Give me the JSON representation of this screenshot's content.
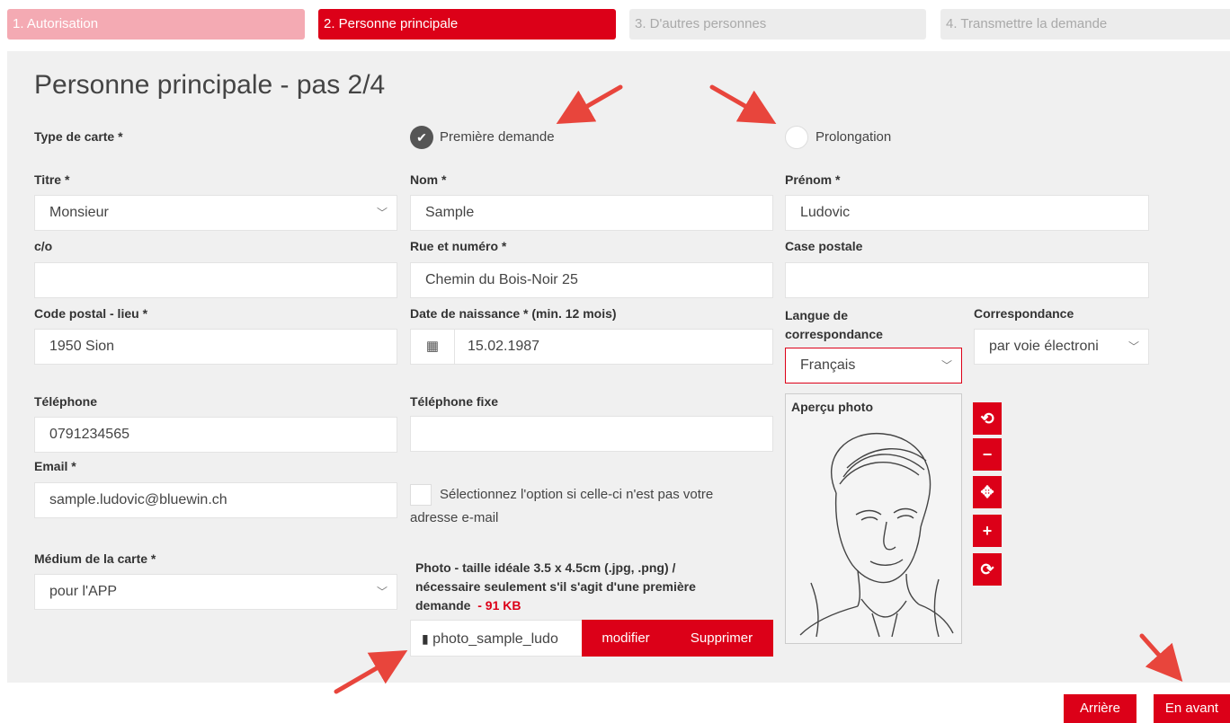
{
  "steps": [
    {
      "label": "1. Autorisation"
    },
    {
      "label": "2. Personne principale"
    },
    {
      "label": "3. D'autres personnes"
    },
    {
      "label": "4. Transmettre la demande"
    }
  ],
  "page_title": "Personne principale - pas 2/4",
  "card_type": {
    "label": "Type de carte *",
    "options": [
      {
        "label": "Première demande",
        "selected": true
      },
      {
        "label": "Prolongation",
        "selected": false
      }
    ]
  },
  "fields": {
    "titre": {
      "label": "Titre *",
      "value": "Monsieur"
    },
    "nom": {
      "label": "Nom *",
      "value": "Sample"
    },
    "prenom": {
      "label": "Prénom *",
      "value": "Ludovic"
    },
    "co": {
      "label": "c/o",
      "value": ""
    },
    "rue": {
      "label": "Rue et numéro *",
      "value": "Chemin du Bois-Noir 25"
    },
    "case_postale": {
      "label": "Case postale",
      "value": ""
    },
    "code_postal": {
      "label": "Code postal - lieu *",
      "value": "1950 Sion"
    },
    "date_naissance": {
      "label": "Date de naissance * (min. 12 mois)",
      "value": "15.02.1987"
    },
    "langue_l1": "Langue de",
    "langue_l2": "correspondance",
    "langue_value": "Français",
    "correspondance": {
      "label": "Correspondance",
      "value": "par voie électroni"
    },
    "telephone": {
      "label": "Téléphone",
      "value": "0791234565"
    },
    "telephone_fixe": {
      "label": "Téléphone fixe",
      "value": ""
    },
    "email": {
      "label": "Email *",
      "value": "sample.ludovic@bluewin.ch"
    },
    "email_option_l1": "Sélectionnez l'option si celle-ci n'est pas votre",
    "email_option_l2": "adresse e-mail",
    "medium": {
      "label": "Médium de la carte *",
      "value": "pour l'APP"
    }
  },
  "photo": {
    "label_l1": "Photo - taille idéale 3.5 x 4.5cm (.jpg, .png) /",
    "label_l2": "nécessaire seulement s'il s'agit d'une première",
    "label_l3": "demande",
    "size": "- 91 KB",
    "filename": "photo_sample_ludo",
    "modify_label": "modifier",
    "delete_label": "Supprimer",
    "preview_label": "Aperçu photo"
  },
  "photo_tools": [
    {
      "icon": "rotate-left-icon",
      "glyph": "⟲"
    },
    {
      "icon": "zoom-out-icon",
      "glyph": "−"
    },
    {
      "icon": "move-icon",
      "glyph": "✥"
    },
    {
      "icon": "zoom-in-icon",
      "glyph": "+"
    },
    {
      "icon": "rotate-right-icon",
      "glyph": "⟳"
    }
  ],
  "nav": {
    "back_label": "Arrière",
    "next_label": "En avant"
  },
  "colors": {
    "accent": "#dc0018",
    "annotation_arrow": "#e8453c"
  }
}
